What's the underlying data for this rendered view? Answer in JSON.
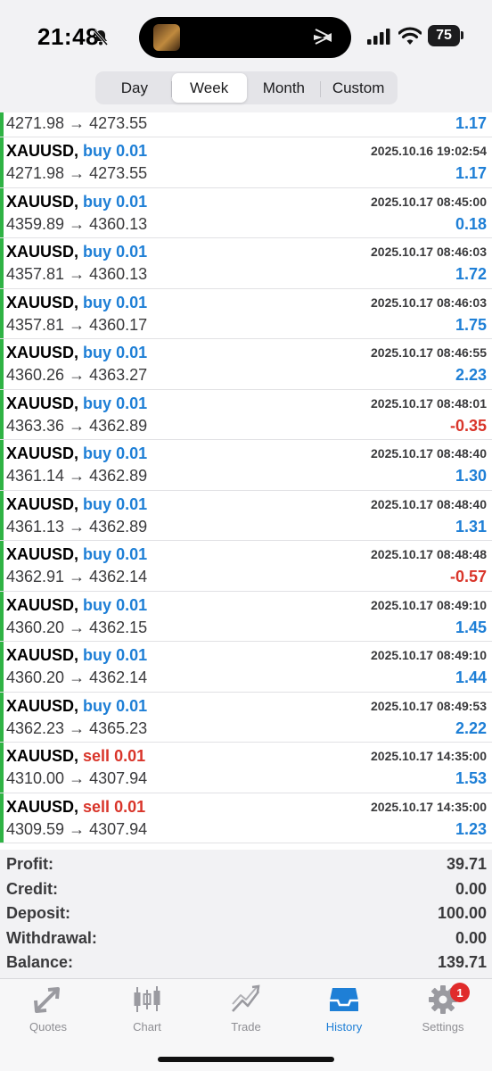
{
  "status_bar": {
    "time": "21:48",
    "battery": "75"
  },
  "period_tabs": {
    "items": [
      "Day",
      "Week",
      "Month",
      "Custom"
    ],
    "selected": "Week"
  },
  "deals": [
    {
      "symbol": "",
      "direction": "",
      "volume": "",
      "time": "",
      "open_price": "4271.98",
      "close_price": "4273.55",
      "profit": "1.17",
      "partial": true
    },
    {
      "symbol": "XAUUSD,",
      "direction": "buy",
      "volume": "0.01",
      "time": "2025.10.16 19:02:54",
      "open_price": "4271.98",
      "close_price": "4273.55",
      "profit": "1.17"
    },
    {
      "symbol": "XAUUSD,",
      "direction": "buy",
      "volume": "0.01",
      "time": "2025.10.17 08:45:00",
      "open_price": "4359.89",
      "close_price": "4360.13",
      "profit": "0.18"
    },
    {
      "symbol": "XAUUSD,",
      "direction": "buy",
      "volume": "0.01",
      "time": "2025.10.17 08:46:03",
      "open_price": "4357.81",
      "close_price": "4360.13",
      "profit": "1.72"
    },
    {
      "symbol": "XAUUSD,",
      "direction": "buy",
      "volume": "0.01",
      "time": "2025.10.17 08:46:03",
      "open_price": "4357.81",
      "close_price": "4360.17",
      "profit": "1.75"
    },
    {
      "symbol": "XAUUSD,",
      "direction": "buy",
      "volume": "0.01",
      "time": "2025.10.17 08:46:55",
      "open_price": "4360.26",
      "close_price": "4363.27",
      "profit": "2.23"
    },
    {
      "symbol": "XAUUSD,",
      "direction": "buy",
      "volume": "0.01",
      "time": "2025.10.17 08:48:01",
      "open_price": "4363.36",
      "close_price": "4362.89",
      "profit": "-0.35"
    },
    {
      "symbol": "XAUUSD,",
      "direction": "buy",
      "volume": "0.01",
      "time": "2025.10.17 08:48:40",
      "open_price": "4361.14",
      "close_price": "4362.89",
      "profit": "1.30"
    },
    {
      "symbol": "XAUUSD,",
      "direction": "buy",
      "volume": "0.01",
      "time": "2025.10.17 08:48:40",
      "open_price": "4361.13",
      "close_price": "4362.89",
      "profit": "1.31"
    },
    {
      "symbol": "XAUUSD,",
      "direction": "buy",
      "volume": "0.01",
      "time": "2025.10.17 08:48:48",
      "open_price": "4362.91",
      "close_price": "4362.14",
      "profit": "-0.57"
    },
    {
      "symbol": "XAUUSD,",
      "direction": "buy",
      "volume": "0.01",
      "time": "2025.10.17 08:49:10",
      "open_price": "4360.20",
      "close_price": "4362.15",
      "profit": "1.45"
    },
    {
      "symbol": "XAUUSD,",
      "direction": "buy",
      "volume": "0.01",
      "time": "2025.10.17 08:49:10",
      "open_price": "4360.20",
      "close_price": "4362.14",
      "profit": "1.44"
    },
    {
      "symbol": "XAUUSD,",
      "direction": "buy",
      "volume": "0.01",
      "time": "2025.10.17 08:49:53",
      "open_price": "4362.23",
      "close_price": "4365.23",
      "profit": "2.22"
    },
    {
      "symbol": "XAUUSD,",
      "direction": "sell",
      "volume": "0.01",
      "time": "2025.10.17 14:35:00",
      "open_price": "4310.00",
      "close_price": "4307.94",
      "profit": "1.53"
    },
    {
      "symbol": "XAUUSD,",
      "direction": "sell",
      "volume": "0.01",
      "time": "2025.10.17 14:35:00",
      "open_price": "4309.59",
      "close_price": "4307.94",
      "profit": "1.23"
    }
  ],
  "summary": [
    {
      "label": "Profit:",
      "value": "39.71"
    },
    {
      "label": "Credit:",
      "value": "0.00"
    },
    {
      "label": "Deposit:",
      "value": "100.00"
    },
    {
      "label": "Withdrawal:",
      "value": "0.00"
    },
    {
      "label": "Balance:",
      "value": "139.71"
    }
  ],
  "tab_bar": {
    "items": [
      {
        "label": "Quotes",
        "icon": "quotes-arrows-icon"
      },
      {
        "label": "Chart",
        "icon": "candlestick-chart-icon"
      },
      {
        "label": "Trade",
        "icon": "trade-trend-icon"
      },
      {
        "label": "History",
        "icon": "history-inbox-icon",
        "active": true
      },
      {
        "label": "Settings",
        "icon": "gear-icon",
        "badge": "1"
      }
    ]
  },
  "colors": {
    "buy": "#1e7fd6",
    "sell": "#d9352a",
    "profit_positive": "#1e7fd6",
    "profit_negative": "#d9352a",
    "row_marker": "#2fb344",
    "tab_active": "#1e7fd6",
    "tab_inactive": "#8e8e93"
  }
}
